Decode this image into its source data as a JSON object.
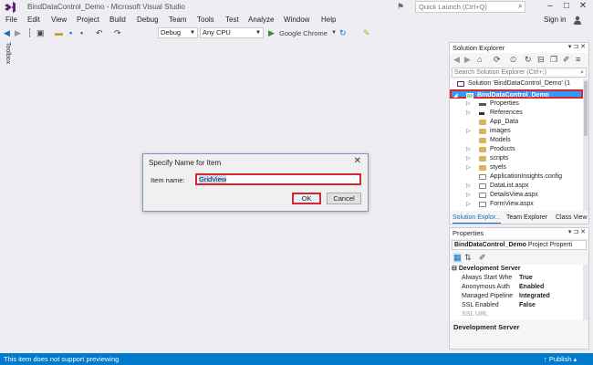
{
  "title_bar": {
    "title": "BindDataControl_Demo - Microsoft Visual Studio",
    "quick_launch_placeholder": "Quick Launch (Ctrl+Q)"
  },
  "menu": {
    "items": [
      "File",
      "Edit",
      "View",
      "Project",
      "Build",
      "Debug",
      "Team",
      "Tools",
      "Test",
      "Analyze",
      "Window",
      "Help"
    ],
    "sign_in": "Sign in"
  },
  "toolbar": {
    "configuration": "Debug",
    "platform": "Any CPU",
    "run_target": "Google Chrome"
  },
  "toolbox": {
    "label": "Toolbox"
  },
  "dialog": {
    "title": "Specify Name for Item",
    "item_name_label": "Item name:",
    "item_name_value": "GridView",
    "ok_label": "OK",
    "cancel_label": "Cancel"
  },
  "solution_explorer": {
    "title": "Solution Explorer",
    "search_placeholder": "Search Solution Explorer (Ctrl+;)",
    "solution_label": "Solution 'BindDataControl_Demo' (1",
    "project_label": "BindDataControl_Demo",
    "items": [
      {
        "label": "Properties",
        "type": "properties",
        "expandable": true
      },
      {
        "label": "References",
        "type": "references",
        "expandable": true
      },
      {
        "label": "App_Data",
        "type": "folder",
        "expandable": false
      },
      {
        "label": "images",
        "type": "folder",
        "expandable": true
      },
      {
        "label": "Models",
        "type": "folder",
        "expandable": false
      },
      {
        "label": "Products",
        "type": "folder",
        "expandable": true
      },
      {
        "label": "scripts",
        "type": "folder",
        "expandable": true
      },
      {
        "label": "styels",
        "type": "folder",
        "expandable": true
      },
      {
        "label": "ApplicationInsights.config",
        "type": "file",
        "expandable": false
      },
      {
        "label": "DataList.aspx",
        "type": "file",
        "expandable": true
      },
      {
        "label": "DetailsView.aspx",
        "type": "file",
        "expandable": true
      },
      {
        "label": "FormView.aspx",
        "type": "file",
        "expandable": true
      }
    ],
    "tabs": [
      "Solution Explor...",
      "Team Explorer",
      "Class View"
    ]
  },
  "properties_pane": {
    "title": "Properties",
    "object_name": "BindDataControl_Demo",
    "object_type": "Project Properti",
    "category": "Development Server",
    "rows": [
      {
        "name": "Always Start Whe",
        "value": "True"
      },
      {
        "name": "Anonymous Auth",
        "value": "Enabled"
      },
      {
        "name": "Managed Pipeline",
        "value": "Integrated"
      },
      {
        "name": "SSL Enabled",
        "value": "False"
      },
      {
        "name": "SSL URL",
        "value": ""
      }
    ],
    "description_title": "Development Server"
  },
  "status_bar": {
    "message": "This item does not support previewing",
    "publish_label": "Publish"
  },
  "colors": {
    "accent": "#007acc",
    "highlight": "#d6262e",
    "selection": "#3399ff"
  }
}
